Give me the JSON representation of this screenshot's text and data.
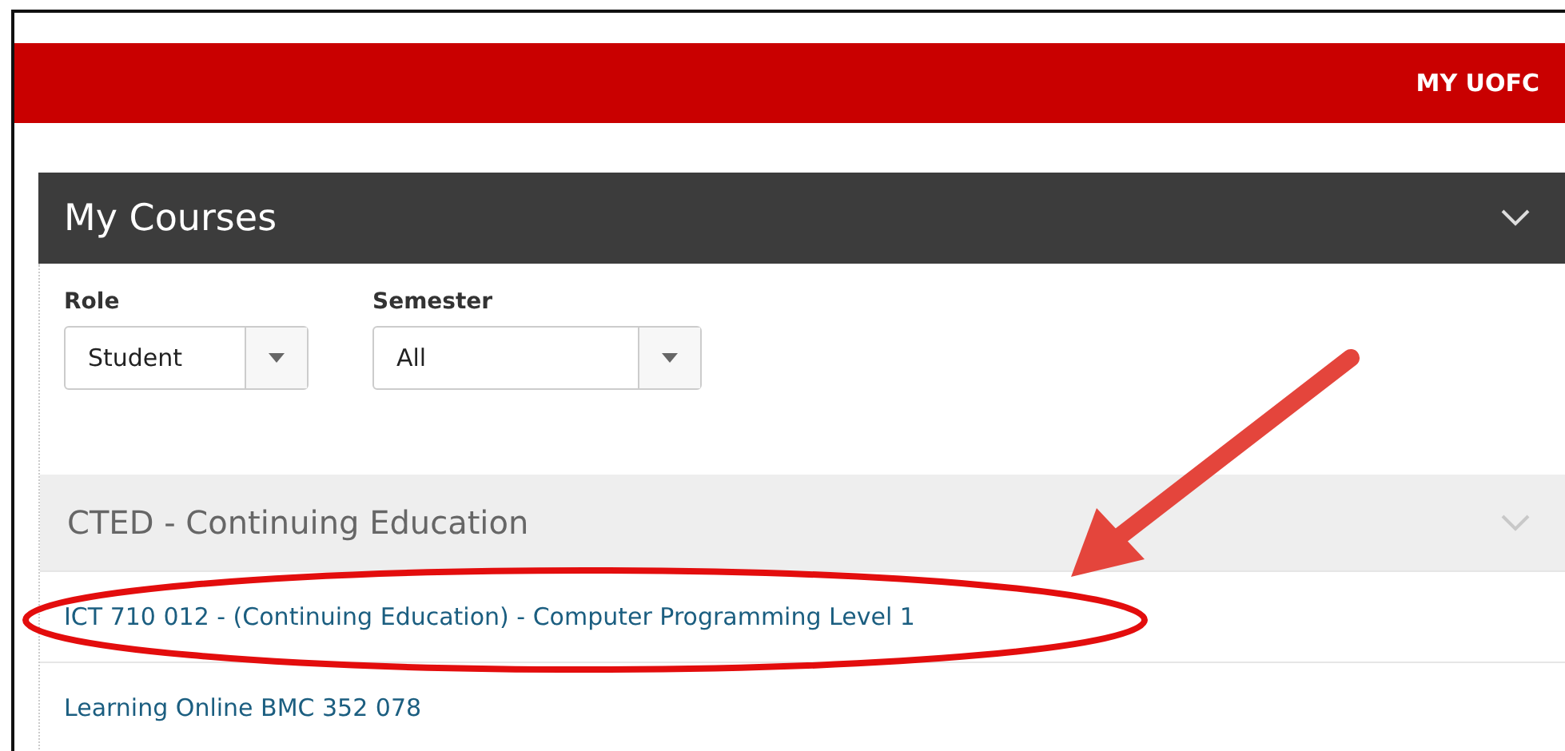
{
  "header": {
    "nav_link": "MY UOFC"
  },
  "panel": {
    "title": "My Courses",
    "filters": [
      {
        "label": "Role",
        "value": "Student"
      },
      {
        "label": "Semester",
        "value": "All"
      }
    ],
    "groups": [
      {
        "title": "CTED - Continuing Education",
        "courses": [
          "ICT 710 012 - (Continuing Education) - Computer Programming Level 1",
          "Learning Online BMC 352 078"
        ]
      }
    ]
  }
}
